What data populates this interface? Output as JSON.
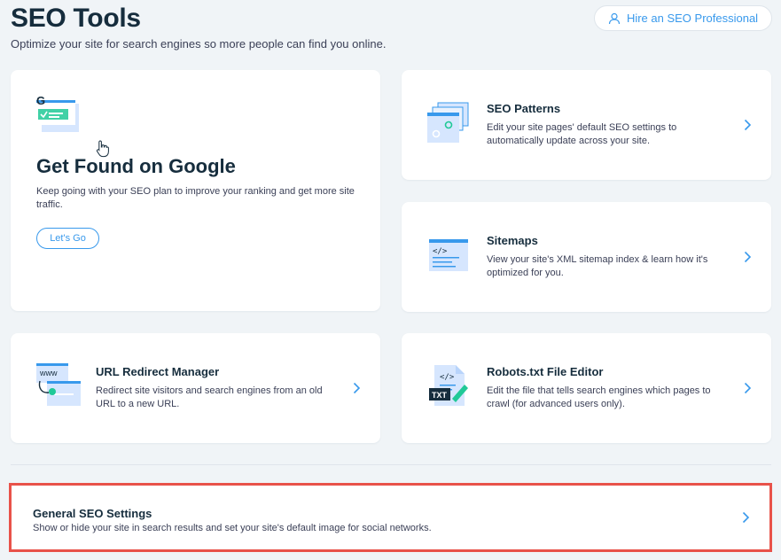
{
  "header": {
    "title": "SEO Tools",
    "subtitle": "Optimize your site for search engines so more people can find you online.",
    "hire_label": "Hire an SEO Professional"
  },
  "hero": {
    "title": "Get Found on Google",
    "description": "Keep going with your SEO plan to improve your ranking and get more site traffic.",
    "button_label": "Let's Go"
  },
  "cards": {
    "seo_patterns": {
      "title": "SEO Patterns",
      "description": "Edit your site pages' default SEO settings to automatically update across your site."
    },
    "sitemaps": {
      "title": "Sitemaps",
      "description": "View your site's XML sitemap index & learn how it's optimized for you."
    },
    "url_redirect": {
      "title": "URL Redirect Manager",
      "description": "Redirect site visitors and search engines from an old URL to a new URL."
    },
    "robots": {
      "title": "Robots.txt File Editor",
      "description": "Edit the file that tells search engines which pages to crawl (for advanced users only)."
    }
  },
  "general": {
    "title": "General SEO Settings",
    "description": "Show or hide your site in search results and set your site's default image for social networks."
  },
  "icons": {
    "robots_txt": "TXT",
    "url_www": "www",
    "sitemap_code": "</>",
    "google_g": "G"
  },
  "colors": {
    "accent": "#3899ec",
    "highlight_border": "#e8524a",
    "background": "#f0f4f7"
  }
}
